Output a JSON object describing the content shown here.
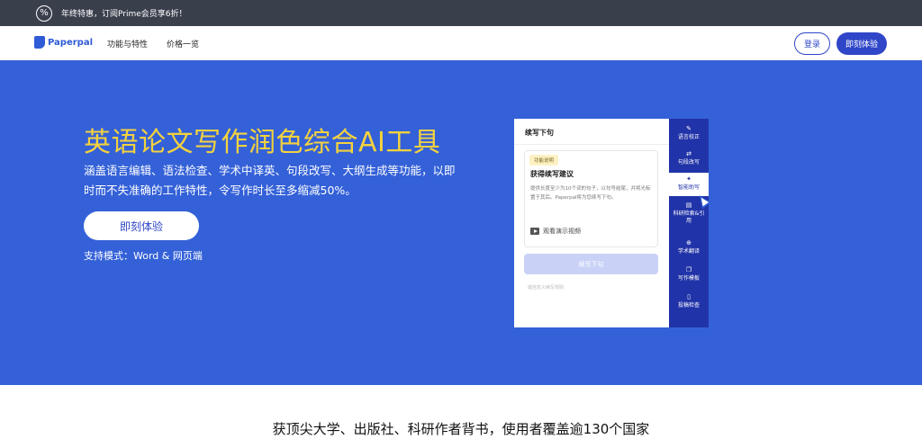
{
  "promo": {
    "icon": "percent-icon",
    "text": "年终特惠，订阅Prime会员享6折！"
  },
  "nav": {
    "logo_text": "Paperpal",
    "links": [
      "功能与特性",
      "价格一览"
    ],
    "login_label": "登录",
    "try_label": "即刻体验"
  },
  "hero": {
    "title": "英语论文写作润色综合AI工具",
    "description": "涵盖语言编辑、语法检查、学术中译英、句段改写、大纲生成等功能，以即时而不失准确的工作特性，令写作时长至多缩减50%。",
    "cta_label": "即刻体验",
    "mode_text": "支持模式：Word & 网页端"
  },
  "card": {
    "heading": "续写下句",
    "tag": "功能说明",
    "title": "获得续写建议",
    "text": "提供长度至少为10个词的句子，以句号结尾，并将光标置于其后。Paperpal将为您续写下句。",
    "video_label": "观看演示视频",
    "continue_label": "续写下句",
    "faded_link": "或自定义续写规则",
    "side_items": [
      {
        "icon": "leaf-icon",
        "glyph": "✎",
        "label": "语言校正"
      },
      {
        "icon": "swap-icon",
        "glyph": "⇄",
        "label": "句段改写"
      },
      {
        "icon": "sparkle-icon",
        "glyph": "✦",
        "label": "智能助写"
      },
      {
        "icon": "book-icon",
        "glyph": "▤",
        "label": "科研检索&引用"
      },
      {
        "icon": "globe-icon",
        "glyph": "⊕",
        "label": "学术翻译"
      },
      {
        "icon": "template-icon",
        "glyph": "❐",
        "label": "写作模板"
      },
      {
        "icon": "document-icon",
        "glyph": "▯",
        "label": "投稿检查"
      }
    ],
    "active_index": 2
  },
  "bottom": {
    "text": "获顶尖大学、出版社、科研作者背书，使用者覆盖逾130个国家"
  },
  "colors": {
    "hero_bg": "#3461d8",
    "title_yellow": "#f4d23e",
    "brand_blue": "#2f46c8",
    "promo_bg": "#3a3f4c",
    "side_bg": "#2133a8"
  }
}
